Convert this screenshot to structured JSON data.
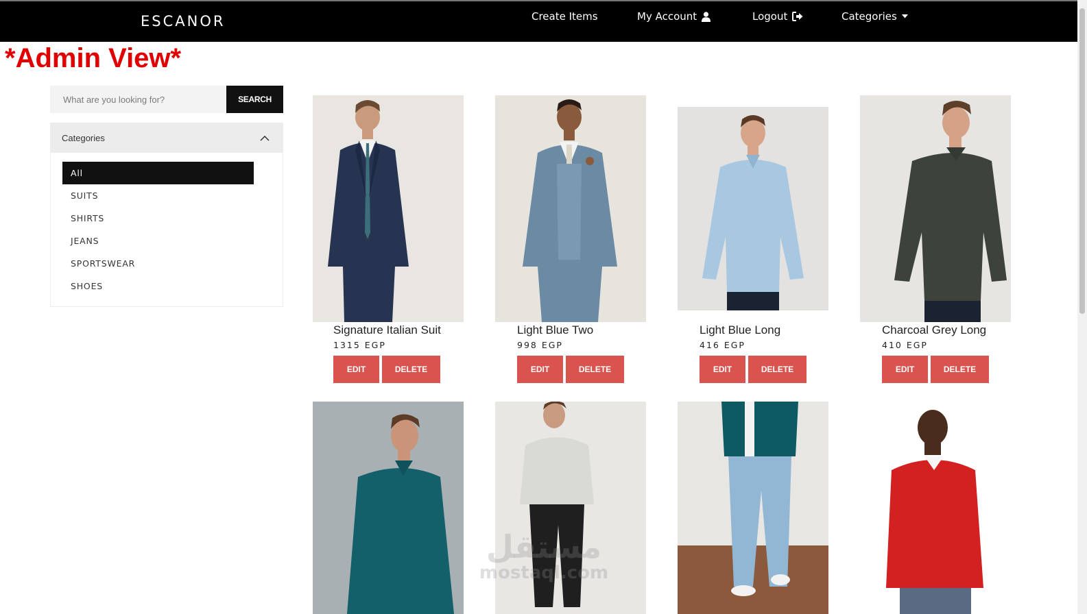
{
  "header": {
    "brand": "ESCANOR",
    "nav": [
      {
        "label": "Create Items",
        "icon": null
      },
      {
        "label": "My Account",
        "icon": "user-icon"
      },
      {
        "label": "Logout",
        "icon": "sign-out-icon"
      },
      {
        "label": "Categories",
        "icon": "caret-down-icon"
      }
    ]
  },
  "banner": {
    "text": "*Admin View*",
    "color": "#e00000"
  },
  "search": {
    "placeholder": "What are you looking for?",
    "button_label": "SEARCH"
  },
  "categories": {
    "title": "Categories",
    "items": [
      "All",
      "SUITS",
      "SHIRTS",
      "JEANS",
      "SPORTSWEAR",
      "SHOES"
    ],
    "selected": "All"
  },
  "products": [
    {
      "name": "Signature Italian Suit",
      "price": "1315 EGP",
      "edit_label": "EDIT",
      "delete_label": "DELETE"
    },
    {
      "name": "Light Blue Two",
      "price": "998 EGP",
      "edit_label": "EDIT",
      "delete_label": "DELETE"
    },
    {
      "name": "Light Blue Long",
      "price": "416 EGP",
      "edit_label": "EDIT",
      "delete_label": "DELETE"
    },
    {
      "name": "Charcoal Grey Long",
      "price": "410 EGP",
      "edit_label": "EDIT",
      "delete_label": "DELETE"
    }
  ],
  "watermark": {
    "arabic": "مستقل",
    "latin": "mostaql.com"
  },
  "colors": {
    "header_bg": "#000000",
    "action_button": "#d9534f",
    "active_category": "#111111"
  }
}
